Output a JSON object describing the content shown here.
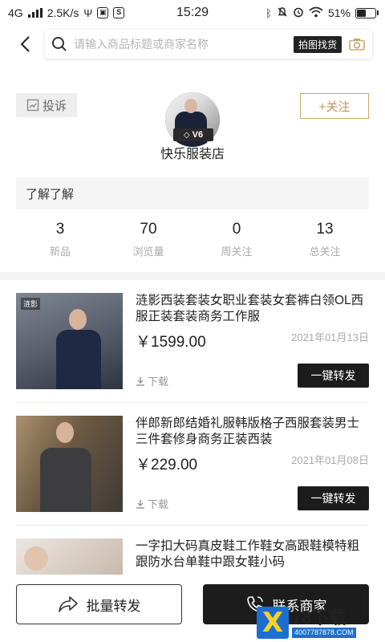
{
  "status_bar": {
    "network": "4G",
    "speed": "2.5K/s",
    "time": "15:29",
    "battery": "51%",
    "battery_level": 0.51
  },
  "header": {
    "search_placeholder": "请输入商品标题或商家名称",
    "photo_search_label": "拍图找货"
  },
  "shop": {
    "complain_label": "投诉",
    "follow_label": "+关注",
    "vip_level": "V6",
    "name": "快乐服装店",
    "intro": "了解了解"
  },
  "stats": [
    {
      "value": "3",
      "label": "新品"
    },
    {
      "value": "70",
      "label": "浏览量"
    },
    {
      "value": "0",
      "label": "周关注"
    },
    {
      "value": "13",
      "label": "总关注"
    }
  ],
  "products": [
    {
      "title": "涟影西装套装女职业套装女套裤白领OL西服正装套装商务工作服",
      "price": "￥1599.00",
      "date": "2021年01月13日",
      "download_label": "下载",
      "forward_label": "一键转发",
      "thumb_tag": "涟影"
    },
    {
      "title": "伴郎新郎结婚礼服韩版格子西服套装男士三件套修身商务正装西装",
      "price": "￥229.00",
      "date": "2021年01月08日",
      "download_label": "下载",
      "forward_label": "一键转发"
    },
    {
      "title": "一字扣大码真皮鞋工作鞋女高跟鞋模特粗跟防水台单鞋中跟女鞋小码"
    }
  ],
  "bottom_bar": {
    "batch_forward_label": "批量转发",
    "contact_label": "联系商家"
  },
  "watermark": {
    "brand": "78下载",
    "site": "4007787878.COM"
  },
  "colors": {
    "accent_gold": "#b99454",
    "dark_button": "#1c1c1c"
  }
}
